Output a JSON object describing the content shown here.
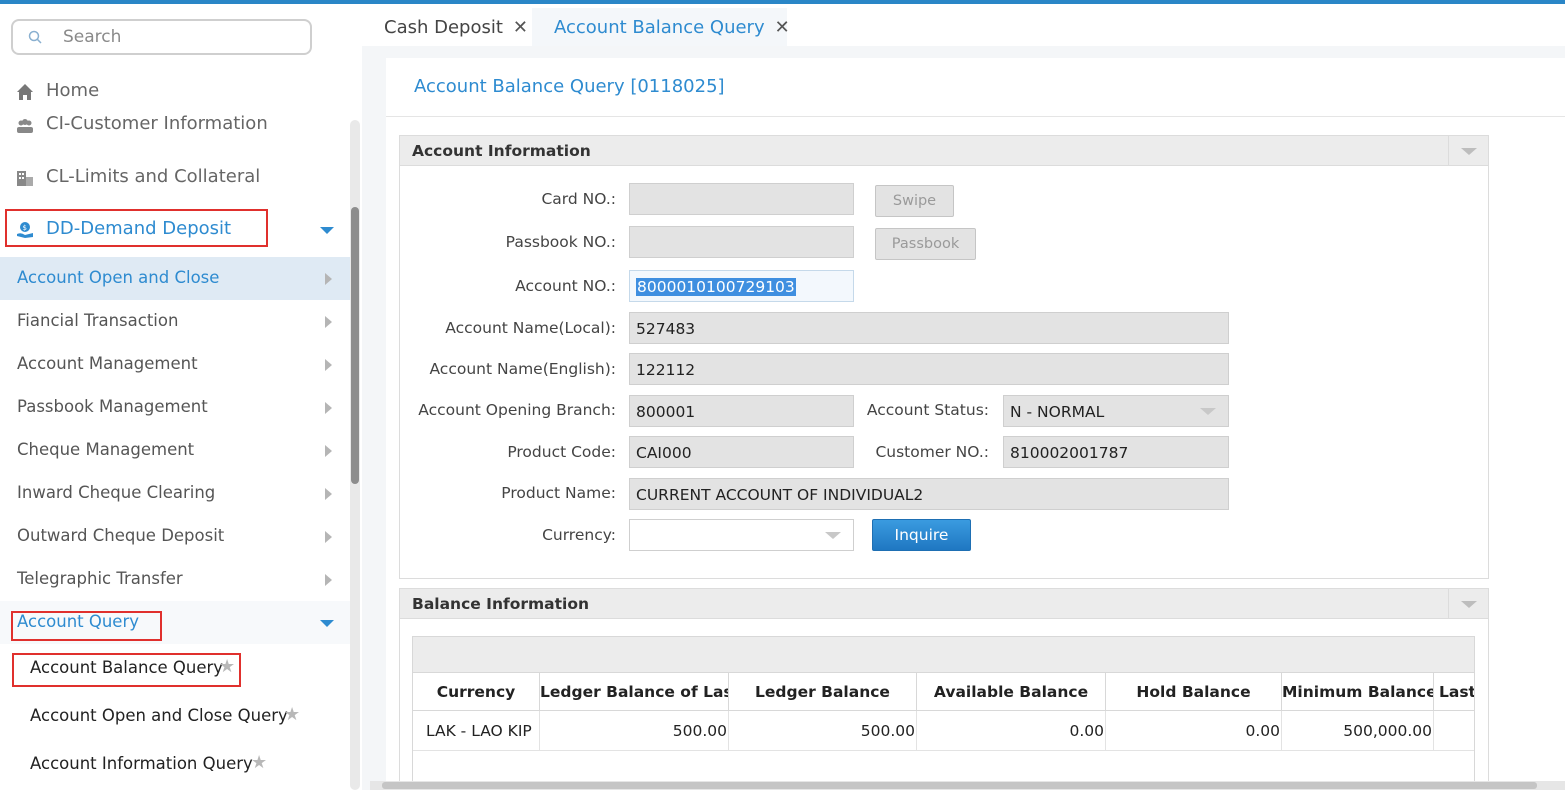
{
  "search": {
    "placeholder": "Search"
  },
  "nav": {
    "home": "Home",
    "ci": "CI-Customer Information",
    "cl": "CL-Limits and Collateral",
    "dd": "DD-Demand Deposit",
    "dd_items": [
      "Account Open and Close",
      "Fiancial Transaction",
      "Account Management",
      "Passbook Management",
      "Cheque Management",
      "Inward Cheque Clearing",
      "Outward Cheque Deposit",
      "Telegraphic Transfer"
    ],
    "account_query": "Account Query",
    "query_items": [
      "Account Balance Query",
      "Account Open and Close Query",
      "Account Information Query"
    ]
  },
  "tabs": [
    {
      "label": "Cash Deposit",
      "close": "✕"
    },
    {
      "label": "Account Balance Query",
      "close": "✕"
    }
  ],
  "page": {
    "title": "Account Balance Query [0118025]"
  },
  "account_info": {
    "title": "Account Information",
    "labels": {
      "card": "Card NO.:",
      "passbook": "Passbook NO.:",
      "account": "Account NO.:",
      "name_local": "Account Name(Local):",
      "name_english": "Account Name(English):",
      "branch": "Account Opening Branch:",
      "status": "Account Status:",
      "product_code": "Product Code:",
      "customer": "Customer NO.:",
      "product_name": "Product Name:",
      "currency": "Currency:"
    },
    "values": {
      "card": "",
      "passbook": "",
      "account": "8000010100729103",
      "name_local": "527483",
      "name_english": "122112",
      "branch": "800001",
      "status": "N - NORMAL",
      "product_code": "CAI000",
      "customer": "810002001787",
      "product_name": "CURRENT ACCOUNT OF INDIVIDUAL2",
      "currency": ""
    },
    "buttons": {
      "swipe": "Swipe",
      "passbook": "Passbook",
      "inquire": "Inquire"
    }
  },
  "balance_info": {
    "title": "Balance Information",
    "columns": [
      "Currency",
      "Ledger Balance of Last...",
      "Ledger Balance",
      "Available Balance",
      "Hold Balance",
      "Minimum Balance",
      "Last"
    ],
    "rows": [
      [
        "LAK - LAO KIP",
        "500.00",
        "500.00",
        "0.00",
        "0.00",
        "500,000.00",
        ""
      ]
    ]
  },
  "colors": {
    "accent": "#2e8bd0",
    "highlight_box": "#e0302d",
    "button_primary": "#1f77c2"
  },
  "icons": [
    "search-icon",
    "home-icon",
    "customers-icon",
    "buildings-icon",
    "deposit-icon",
    "chevron-right-icon",
    "caret-down-icon",
    "star-icon",
    "close-icon"
  ]
}
